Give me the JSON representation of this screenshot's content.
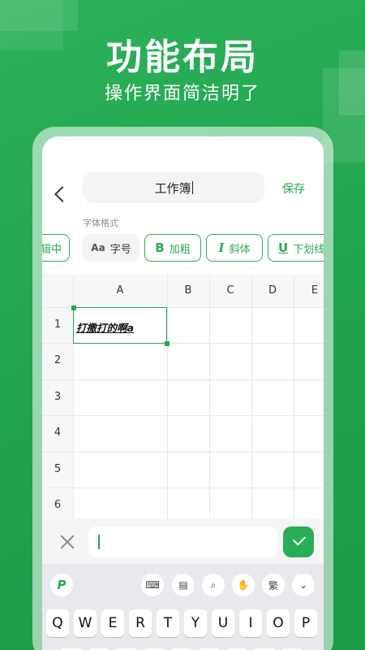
{
  "hero": {
    "title": "功能布局",
    "subtitle": "操作界面简洁明了"
  },
  "header": {
    "title": "工作簿",
    "save_label": "保存"
  },
  "format": {
    "section_label": "字体格式",
    "partial_left": "辑中",
    "font_size": {
      "icon": "Aa",
      "label": "字号"
    },
    "bold": {
      "icon": "B",
      "label": "加粗"
    },
    "italic": {
      "icon": "I",
      "label": "斜体"
    },
    "underline": {
      "icon": "U",
      "label": "下划线"
    }
  },
  "sheet": {
    "columns": [
      "A",
      "B",
      "C",
      "D",
      "E"
    ],
    "rows": [
      "1",
      "2",
      "3",
      "4",
      "5",
      "6"
    ],
    "cell_a1": "打撒打的啊a"
  },
  "keyboard": {
    "logo": "P",
    "traditional_label": "繁",
    "row1": [
      "Q",
      "W",
      "E",
      "R",
      "T",
      "Y",
      "U",
      "I",
      "O",
      "P"
    ]
  },
  "colors": {
    "brand_green": "#23a64f",
    "background_green": "#22a64e"
  }
}
